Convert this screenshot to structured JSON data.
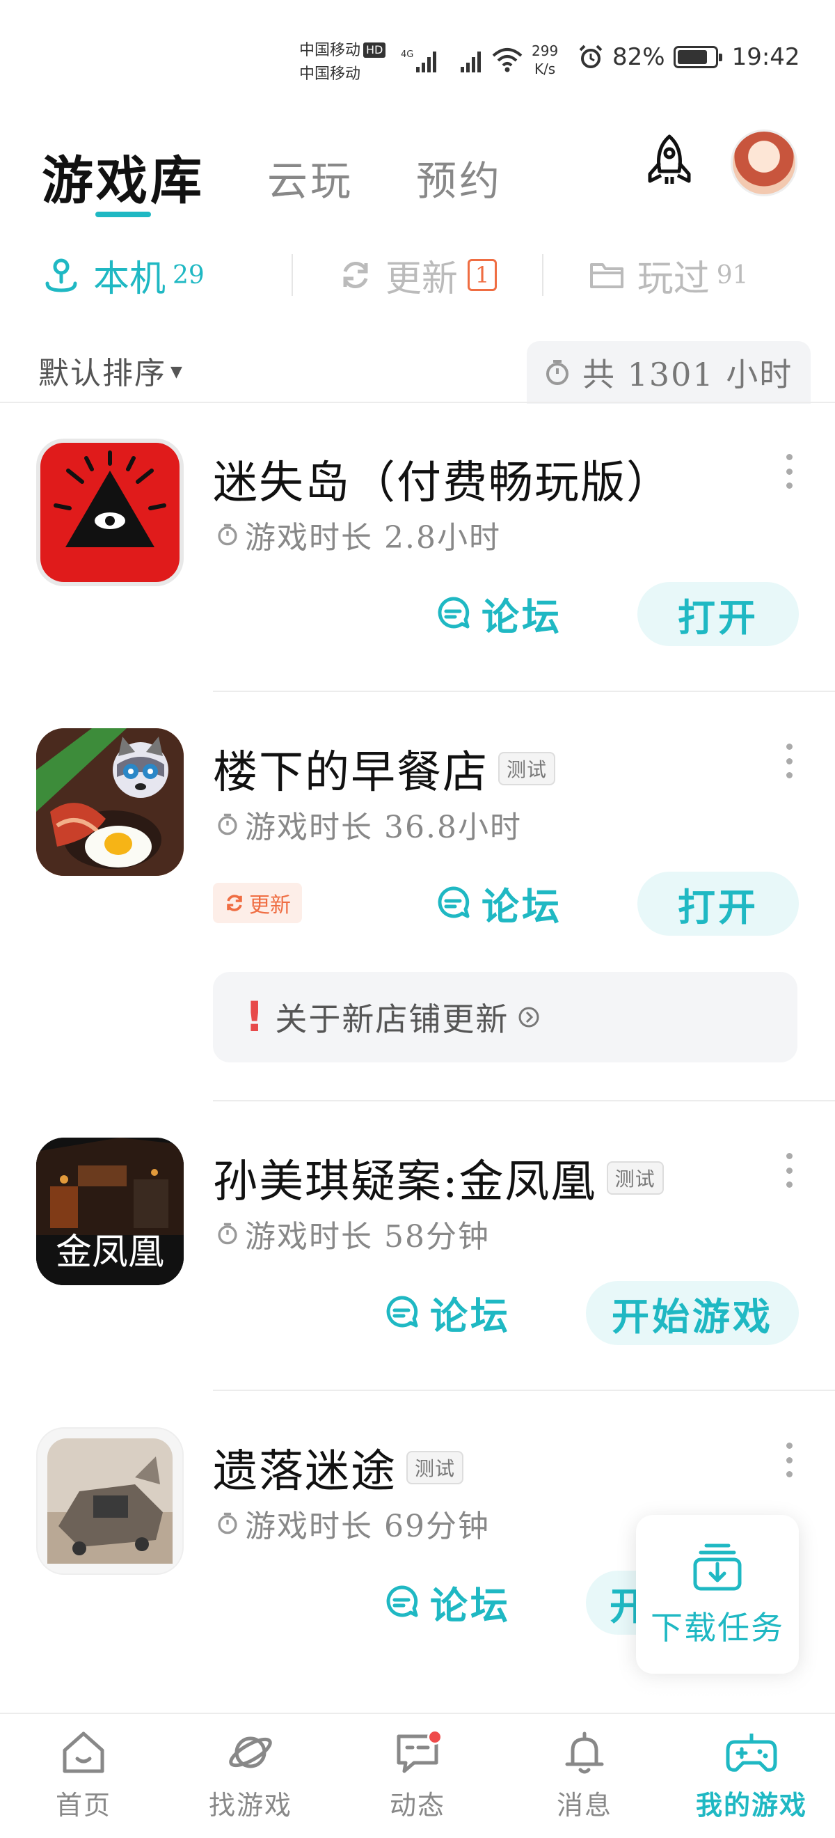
{
  "status_bar": {
    "carrier1": "中国移动",
    "carrier1_badge": "HD",
    "carrier2": "中国移动",
    "net_speed_value": "299",
    "net_speed_unit": "K/s",
    "battery_percent": "82%",
    "battery_level": 0.82,
    "time": "19:42"
  },
  "header": {
    "tabs": [
      {
        "label": "游戏库"
      },
      {
        "label": "云玩"
      },
      {
        "label": "预约"
      }
    ],
    "rocket_icon": "rocket-icon",
    "avatar_icon": "user-avatar"
  },
  "sub_tabs": [
    {
      "label": "本机",
      "count": "29",
      "icon": "device-icon"
    },
    {
      "label": "更新",
      "count": "1",
      "icon": "refresh-icon"
    },
    {
      "label": "玩过",
      "count": "91",
      "icon": "folder-icon"
    }
  ],
  "sort": {
    "label": "默认排序",
    "total_hours": "共 1301 小时"
  },
  "games": [
    {
      "title": "迷失岛（付费畅玩版）",
      "beta": "",
      "play_time": "游戏时长 2.8小时",
      "forum": "论坛",
      "action": "打开",
      "update_tag": "",
      "notice": ""
    },
    {
      "title": "楼下的早餐店",
      "beta": "测试",
      "play_time": "游戏时长 36.8小时",
      "forum": "论坛",
      "action": "打开",
      "update_tag": "更新",
      "notice": "关于新店铺更新"
    },
    {
      "title": "孙美琪疑案:金凤凰",
      "beta": "测试",
      "icon_text": "金凤凰",
      "play_time": "游戏时长 58分钟",
      "forum": "论坛",
      "action": "开始游戏",
      "update_tag": "",
      "notice": ""
    },
    {
      "title": "遗落迷途",
      "beta": "测试",
      "play_time": "游戏时长 69分钟",
      "forum": "论坛",
      "action": "开",
      "update_tag": "",
      "notice": ""
    }
  ],
  "download_task": {
    "label": "下载任务"
  },
  "bottom_nav": [
    {
      "label": "首页",
      "icon": "home-icon"
    },
    {
      "label": "找游戏",
      "icon": "planet-icon"
    },
    {
      "label": "动态",
      "icon": "chat-icon"
    },
    {
      "label": "消息",
      "icon": "bell-icon"
    },
    {
      "label": "我的游戏",
      "icon": "gamepad-icon"
    }
  ],
  "colors": {
    "accent": "#1fb8c3",
    "update": "#ef6d42",
    "alert": "#e74a4a"
  }
}
